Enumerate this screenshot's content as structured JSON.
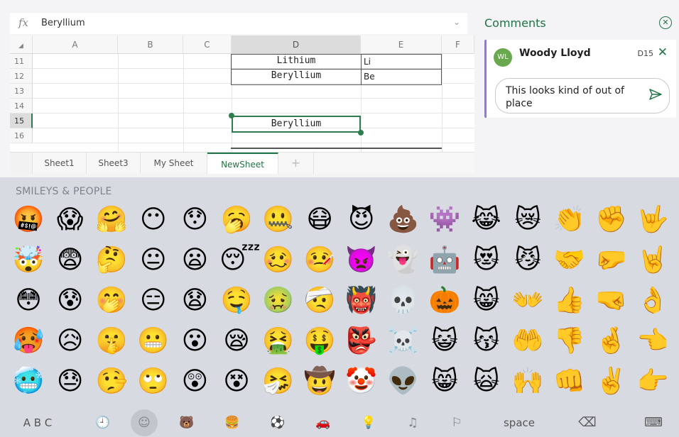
{
  "formula_bar": {
    "fx": "fx",
    "value": "Beryllium",
    "dropdown": "⌄"
  },
  "grid": {
    "columns": [
      "A",
      "B",
      "C",
      "D",
      "E",
      "F"
    ],
    "selected_column": "D",
    "rows": [
      "11",
      "12",
      "13",
      "14",
      "15",
      "16"
    ],
    "selected_row": "15",
    "cells": {
      "d11": "Lithium",
      "e11": "Li",
      "d12": "Beryllium",
      "e12": "Be",
      "d15": "Beryllium"
    }
  },
  "sheet_tabs": {
    "tabs": [
      "Sheet1",
      "Sheet3",
      "My Sheet",
      "NewSheet"
    ],
    "active": "NewSheet",
    "add": "+"
  },
  "comments": {
    "title": "Comments",
    "close_all": "✕",
    "card": {
      "avatar": "WL",
      "author": "Woody Lloyd",
      "cell_ref": "D15",
      "close": "✕",
      "reply_text": "This looks kind of out of place",
      "send_icon": "send-icon"
    }
  },
  "keyboard": {
    "section_label": "SMILEYS & PEOPLE",
    "emoji_rows": [
      [
        "🤬",
        "😱",
        "🤗",
        "😶",
        "😯",
        "🥱",
        "🤐",
        "😷",
        "😈",
        "💩",
        "👾",
        "😹",
        "😿",
        "👏",
        "✊",
        "🤟"
      ],
      [
        "🤯",
        "😨",
        "🤔",
        "😐",
        "😦",
        "😴",
        "🥴",
        "🤒",
        "👿",
        "👻",
        "🤖",
        "😻",
        "😼",
        "🤝",
        "🤛",
        "🤘"
      ],
      [
        "😳",
        "😰",
        "🤭",
        "😑",
        "😧",
        "🤤",
        "🤢",
        "🤕",
        "👹",
        "💀",
        "🎃",
        "😸",
        "👐",
        "👍",
        "🤜",
        "👌"
      ],
      [
        "🥵",
        "😥",
        "🤫",
        "😬",
        "😮",
        "😪",
        "🤮",
        "🤑",
        "👺",
        "☠️",
        "😺",
        "😽",
        "🤲",
        "👎",
        "🤞",
        "👈"
      ],
      [
        "🥶",
        "😓",
        "🤥",
        "🙄",
        "😲",
        "😵",
        "🤧",
        "🤠",
        "🤡",
        "👽",
        "😸",
        "🙀",
        "🙌",
        "👊",
        "✌️",
        "👉"
      ]
    ],
    "bottom_bar": {
      "abc": "A B C",
      "categories": [
        "🕘",
        "☺",
        "🐻",
        "🍔",
        "⚽",
        "🚗",
        "💡",
        "♫",
        "⚐"
      ],
      "space": "space",
      "delete": "⌫",
      "hide": "⌨"
    }
  },
  "colors": {
    "accent": "#217346",
    "selection": "#2e7d4f",
    "avatar": "#6aa84f",
    "keyboard_bg": "#d7dae0"
  }
}
